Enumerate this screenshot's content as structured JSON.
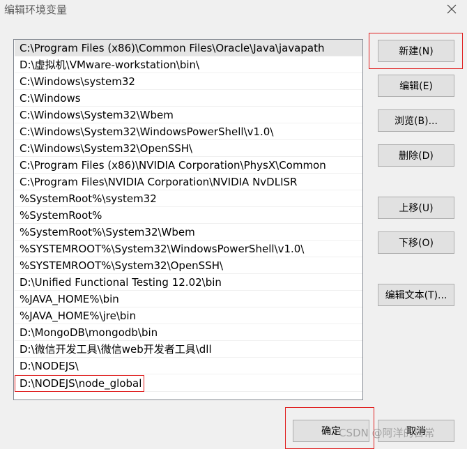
{
  "window": {
    "title": "编辑环境变量"
  },
  "paths": [
    "C:\\Program Files (x86)\\Common Files\\Oracle\\Java\\javapath",
    "D:\\虚拟机\\VMware-workstation\\bin\\",
    "C:\\Windows\\system32",
    "C:\\Windows",
    "C:\\Windows\\System32\\Wbem",
    "C:\\Windows\\System32\\WindowsPowerShell\\v1.0\\",
    "C:\\Windows\\System32\\OpenSSH\\",
    "C:\\Program Files (x86)\\NVIDIA Corporation\\PhysX\\Common",
    "C:\\Program Files\\NVIDIA Corporation\\NVIDIA NvDLISR",
    "%SystemRoot%\\system32",
    "%SystemRoot%",
    "%SystemRoot%\\System32\\Wbem",
    "%SYSTEMROOT%\\System32\\WindowsPowerShell\\v1.0\\",
    "%SYSTEMROOT%\\System32\\OpenSSH\\",
    "D:\\Unified Functional Testing 12.02\\bin",
    "%JAVA_HOME%\\bin",
    "%JAVA_HOME%\\jre\\bin",
    "D:\\MongoDB\\mongodb\\bin",
    "D:\\微信开发工具\\微信web开发者工具\\dll",
    "D:\\NODEJS\\",
    "D:\\NODEJS\\node_global"
  ],
  "buttons": {
    "new": "新建(N)",
    "edit": "编辑(E)",
    "browse": "浏览(B)...",
    "delete": "删除(D)",
    "move_up": "上移(U)",
    "move_down": "下移(O)",
    "edit_text": "编辑文本(T)...",
    "ok": "确定",
    "cancel": "取消"
  },
  "watermark": "CSDN @阿洋的日常",
  "colors": {
    "highlight": "#e02020",
    "selected_row": "#e5e5e5"
  }
}
